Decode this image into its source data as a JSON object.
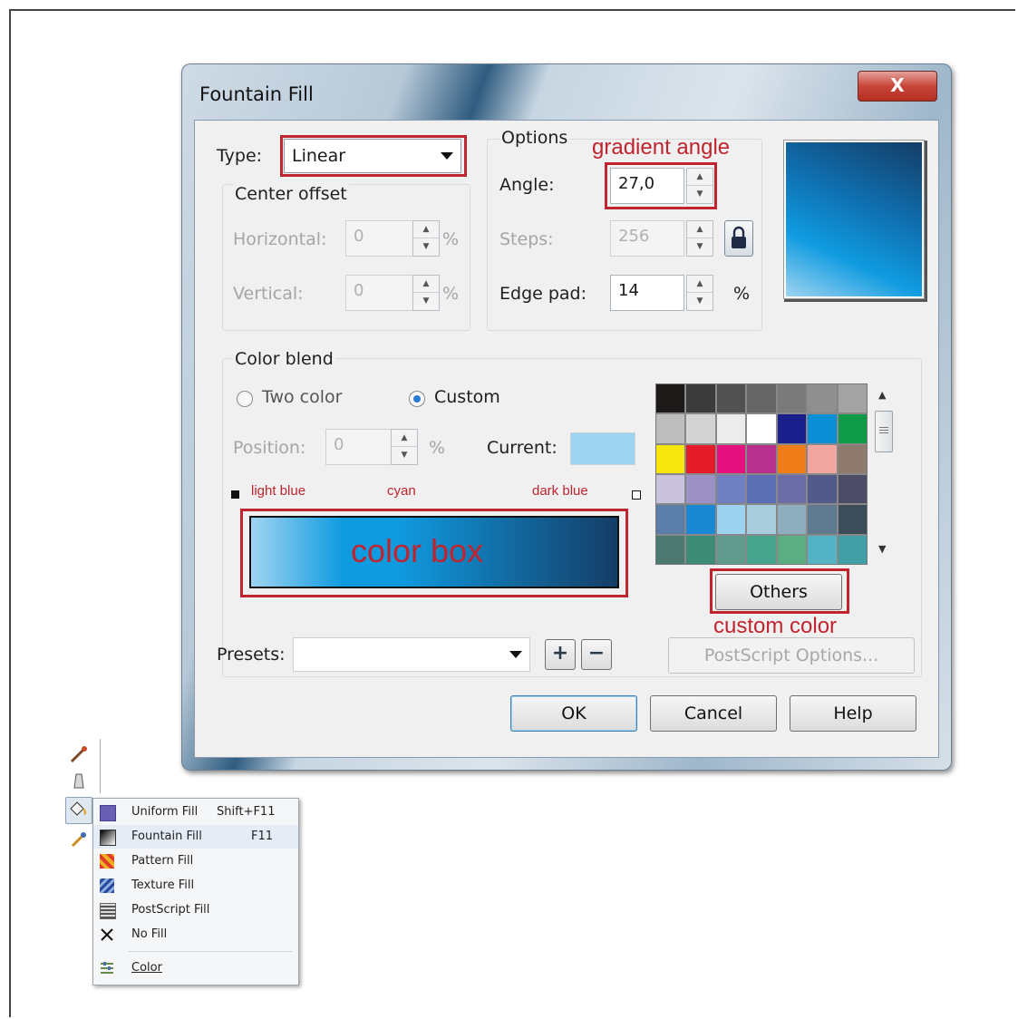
{
  "dialog": {
    "title": "Fountain Fill",
    "close_label": "X",
    "type_label": "Type:",
    "type_value": "Linear",
    "center_offset_label": "Center offset",
    "horizontal_label": "Horizontal:",
    "horizontal_value": "0",
    "vertical_label": "Vertical:",
    "vertical_value": "0",
    "percent": "%",
    "options_label": "Options",
    "angle_label": "Angle:",
    "angle_value": "27,0",
    "steps_label": "Steps:",
    "steps_value": "256",
    "edge_pad_label": "Edge pad:",
    "edge_pad_value": "14",
    "color_blend_label": "Color blend",
    "two_color_label": "Two color",
    "custom_label": "Custom",
    "position_label": "Position:",
    "position_value": "0",
    "current_label": "Current:",
    "current_color": "#9fd4f1",
    "presets_label": "Presets:",
    "presets_value": "",
    "postscript_label": "PostScript Options...",
    "others_label": "Others",
    "ok_label": "OK",
    "cancel_label": "Cancel",
    "help_label": "Help",
    "gradient_colors": [
      "#9fd4f1",
      "#0f9be0",
      "#143d66"
    ],
    "palette": [
      "#1e1a19",
      "#3b3b3b",
      "#515151",
      "#666666",
      "#7a7a7a",
      "#8f8f8f",
      "#a4a4a4",
      "#bdbdbd",
      "#d3d3d3",
      "#ececec",
      "#ffffff",
      "#1a1f8c",
      "#0a8fd6",
      "#0f9a48",
      "#f7e60b",
      "#e41c2a",
      "#e4117f",
      "#b8318d",
      "#ef7c18",
      "#f2a6a0",
      "#8f7a70",
      "#c9c3de",
      "#9b91c4",
      "#6f7fc1",
      "#5b6fb5",
      "#6c6ca6",
      "#525a8a",
      "#4c4c66",
      "#5a7ea8",
      "#1b88d3",
      "#9cd3f0",
      "#a7cddc",
      "#8eadbf",
      "#5f7a8f",
      "#3c4c58",
      "#4c7a70",
      "#3d8b74",
      "#5f9a8d",
      "#47a58e",
      "#5aae82",
      "#54b4c6",
      "#3f9fa5"
    ]
  },
  "annotations": {
    "gradient_angle": "gradient angle",
    "light_blue": "light blue",
    "cyan": "cyan",
    "dark_blue": "dark blue",
    "color_box": "color box",
    "custom_color": "custom color"
  },
  "menu": {
    "items": [
      {
        "label": "Uniform Fill",
        "shortcut": "Shift+F11",
        "icon": "uniform-fill-icon"
      },
      {
        "label": "Fountain Fill",
        "shortcut": "F11",
        "icon": "fountain-fill-icon"
      },
      {
        "label": "Pattern Fill",
        "shortcut": "",
        "icon": "pattern-fill-icon"
      },
      {
        "label": "Texture Fill",
        "shortcut": "",
        "icon": "texture-fill-icon"
      },
      {
        "label": "PostScript Fill",
        "shortcut": "",
        "icon": "postscript-fill-icon"
      },
      {
        "label": "No Fill",
        "shortcut": "",
        "icon": "no-fill-icon"
      },
      {
        "label": "Color",
        "shortcut": "",
        "icon": "color-icon"
      }
    ]
  }
}
